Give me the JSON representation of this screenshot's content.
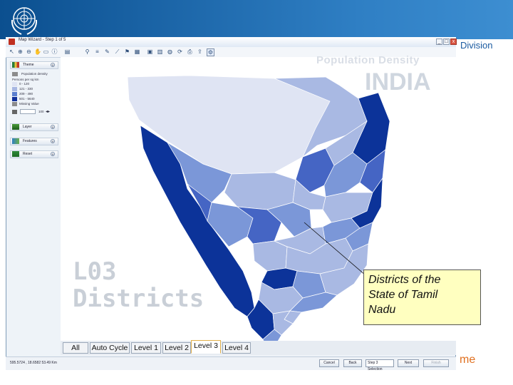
{
  "slide": {
    "division_text": "Division",
    "bottom_text": "me"
  },
  "window": {
    "title": "Map Wizard - Step 1 of 5",
    "buttons": [
      "_",
      "□",
      "x"
    ]
  },
  "toolbar": {
    "icons": [
      "pointer-icon",
      "zoom-in-icon",
      "zoom-out-icon",
      "pan-icon",
      "select-icon",
      "info-icon",
      "label-icon",
      "filter-icon",
      "layers-icon",
      "globe-icon",
      "table-icon",
      "chart-icon",
      "refresh-icon",
      "print-icon",
      "export-icon",
      "settings-icon"
    ]
  },
  "left_panel": {
    "theme_label": "Theme",
    "layer_name": "Population density",
    "legend_title": "Persons per sq km",
    "legend_items": [
      {
        "label": "0 - 120",
        "color": "#dfe4f3"
      },
      {
        "label": "121 - 330",
        "color": "#a7b7e2"
      },
      {
        "label": "209 - 490",
        "color": "#5b7fcf"
      },
      {
        "label": "501 - 5640",
        "color": "#0f2f9a"
      },
      {
        "label": "Missing Value",
        "color": "#8c8c8c"
      }
    ],
    "opacity_value": "100",
    "layer_label": "Layer",
    "features_label": "Features",
    "reset_label": "Reset"
  },
  "map": {
    "title": "Population Density",
    "country": "INDIA",
    "level_line1": "L03",
    "level_line2": "Districts",
    "colors": {
      "water": "#ffffff",
      "low": "#dfe4f3",
      "light": "#a9b9e3",
      "mid": "#7b97d8",
      "dark": "#4565c4",
      "darkest": "#0c3399"
    }
  },
  "callout": {
    "line1": "Districts of the",
    "line2": "State of Tamil",
    "line3": "Nadu"
  },
  "tabs": [
    {
      "label": "All"
    },
    {
      "label": "Auto Cycle"
    },
    {
      "label": "Level 1"
    },
    {
      "label": "Level 2"
    },
    {
      "label": "Level 3",
      "active": true
    },
    {
      "label": "Level 4"
    }
  ],
  "status": {
    "coords": "595.5724 , 18.6582  53.49 Km",
    "cancel_label": "Cancel",
    "back_label": "Back",
    "step_select": "Step 3 Selection",
    "next_label": "Next",
    "finish_label": "Finish"
  }
}
